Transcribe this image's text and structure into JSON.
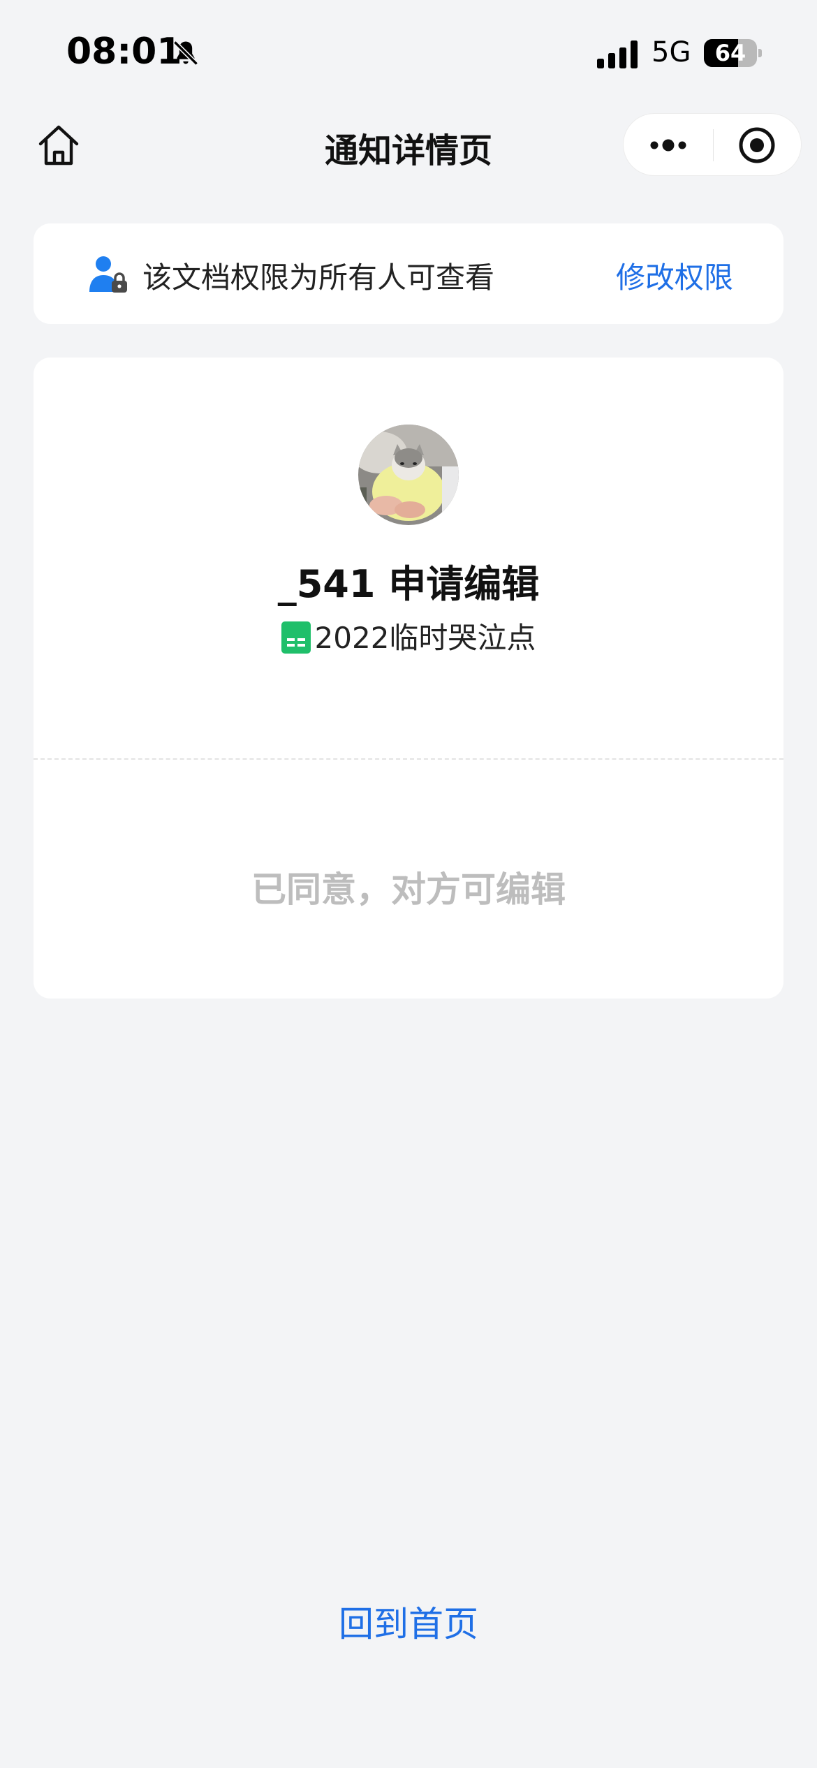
{
  "status_bar": {
    "time": "08:01",
    "network": "5G",
    "battery_level": "64",
    "battery_fraction": 0.64,
    "icons": [
      "bell-slash-icon",
      "cellular-signal-icon",
      "battery-icon"
    ]
  },
  "nav": {
    "title": "通知详情页",
    "icons": [
      "home-icon",
      "more-dots-icon",
      "close-target-icon"
    ]
  },
  "permission": {
    "text": "该文档权限为所有人可查看",
    "action_label": "修改权限",
    "icon": "user-lock-icon"
  },
  "request": {
    "avatar": "cat-avatar",
    "title": "_541 申请编辑",
    "doc_icon": "spreadsheet-icon",
    "doc_name": "2022临时哭泣点",
    "status": "已同意，对方可编辑"
  },
  "footer": {
    "back_home_label": "回到首页"
  },
  "colors": {
    "background": "#f3f4f6",
    "accent": "#1f6fe6",
    "status_gray": "#bdbdbd",
    "sheet_green": "#1fbf6a"
  }
}
